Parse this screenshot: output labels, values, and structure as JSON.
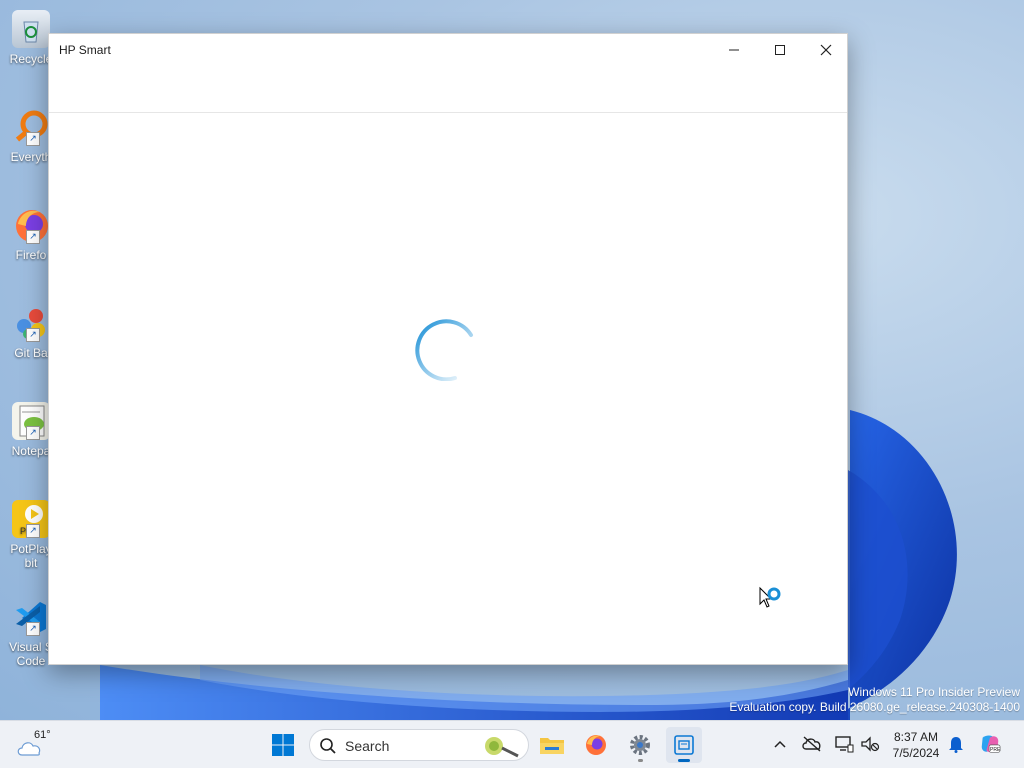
{
  "window": {
    "title": "HP Smart"
  },
  "desktop_icons": [
    {
      "label": "Recycle",
      "icon": "recycle-bin-icon"
    },
    {
      "label": "Everyth",
      "icon": "everything-search-icon"
    },
    {
      "label": "Firefo",
      "icon": "firefox-icon"
    },
    {
      "label": "Git Ba",
      "icon": "git-bash-icon"
    },
    {
      "label": "Notepa",
      "icon": "notepad-plus-plus-icon"
    },
    {
      "label": "PotPlay\nbit",
      "icon": "potplayer-icon"
    },
    {
      "label": "Visual S\nCode",
      "icon": "vscode-icon"
    }
  ],
  "watermark": {
    "line1": "Windows 11 Pro Insider Preview",
    "line2": "Evaluation copy. Build 26080.ge_release.240308-1400"
  },
  "taskbar": {
    "weather_temp": "61°",
    "search_placeholder": "Search",
    "clock_time": "8:37 AM",
    "clock_date": "7/5/2024"
  },
  "colors": {
    "accent": "#0067c0",
    "spinner": "#1a8fd6"
  }
}
